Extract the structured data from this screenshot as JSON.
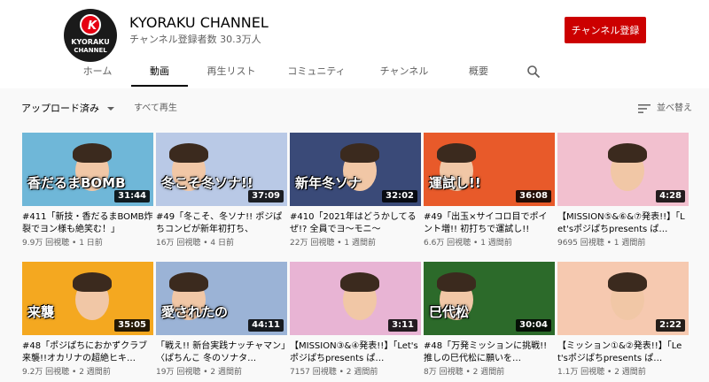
{
  "channel": {
    "name": "KYORAKU CHANNEL",
    "subscribers": "チャンネル登録者数 30.3万人",
    "subscribe_label": "チャンネル登録",
    "logo_mark": "K",
    "logo_line1": "KYORAKU",
    "logo_line2": "CHANNEL",
    "brand_color": "#cc0000"
  },
  "tabs": [
    {
      "label": "ホーム",
      "active": false
    },
    {
      "label": "動画",
      "active": true
    },
    {
      "label": "再生リスト",
      "active": false
    },
    {
      "label": "コミュニティ",
      "active": false
    },
    {
      "label": "チャンネル",
      "active": false
    },
    {
      "label": "概要",
      "active": false
    }
  ],
  "filter": {
    "uploads_label": "アップロード済み",
    "play_all": "すべて再生",
    "sort_label": "並べ替え"
  },
  "videos": [
    {
      "title": "#411「新技・香だるまBOMB炸裂でヨン様も絶笑む！」",
      "views": "9.9万 回視聴",
      "age": "1 日前",
      "duration": "31:44",
      "thumb_text": "香だるまBOMB",
      "bg": "#6fb7d8"
    },
    {
      "title": "#49「冬こそ、冬ソナ!! ポジぱちコンビが新年初打ち、",
      "views": "16万 回視聴",
      "age": "4 日前",
      "duration": "37:09",
      "thumb_text": "冬こそ冬ソナ!!",
      "bg": "#b9c9e6"
    },
    {
      "title": "#410「2021年はどうかしてるぜ!? 全員でヨ〜モニ〜",
      "views": "22万 回視聴",
      "age": "1 週間前",
      "duration": "32:02",
      "thumb_text": "新年冬ソナ",
      "bg": "#3a4a78"
    },
    {
      "title": "#49「出玉×サイコロ目でポイント増!! 初打ちで運試し!!",
      "views": "6.6万 回視聴",
      "age": "1 週間前",
      "duration": "36:08",
      "thumb_text": "運試し!!",
      "bg": "#e85a2a"
    },
    {
      "title": "【MISSION⑤&⑥&⑦発表!!】「Let'sポジぱちpresents ぱ…",
      "views": "9695 回視聴",
      "age": "1 週間前",
      "duration": "4:28",
      "thumb_text": "",
      "bg": "#f2c0cf"
    },
    {
      "title": "#48「ポジぱちにおかずクラブ来襲!!オカリナの超絶ヒキ…",
      "views": "9.2万 回視聴",
      "age": "2 週間前",
      "duration": "35:05",
      "thumb_text": "来襲",
      "bg": "#f4a820"
    },
    {
      "title": "「戦え!! 新台実践ナッチャマン」〈ぱちんこ 冬のソナタ…",
      "views": "19万 回視聴",
      "age": "2 週間前",
      "duration": "44:11",
      "thumb_text": "愛されたの",
      "bg": "#9bb3d6"
    },
    {
      "title": "【MISSION③&④発表!!】「Let'sポジぱちpresents ぱ…",
      "views": "7157 回視聴",
      "age": "2 週間前",
      "duration": "3:11",
      "thumb_text": "",
      "bg": "#e8b4d4"
    },
    {
      "title": "#48「万発ミッションに挑戦!! 推しの巳代松に願いを…",
      "views": "8万 回視聴",
      "age": "2 週間前",
      "duration": "30:04",
      "thumb_text": "巳代松",
      "bg": "#2c6a2a"
    },
    {
      "title": "【ミッション①&②発表!!】「Let'sポジぱちpresents ぱ…",
      "views": "1.1万 回視聴",
      "age": "2 週間前",
      "duration": "2:22",
      "thumb_text": "",
      "bg": "#f6c9b0"
    }
  ],
  "meta_separator": " • "
}
